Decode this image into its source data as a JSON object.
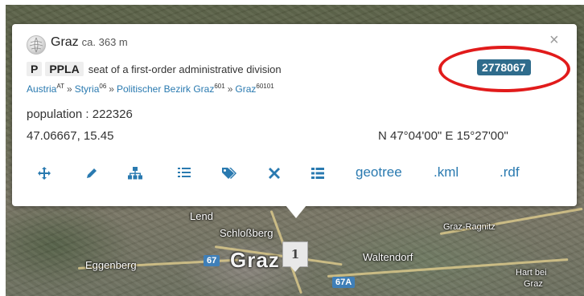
{
  "map": {
    "labels": {
      "lend": "Lend",
      "schlossberg": "Schloßberg",
      "eggenberg": "Eggenberg",
      "graz_big": "Graz",
      "waltendorf": "Waltendorf",
      "graz_ragnitz": "Graz-Ragnitz",
      "hart_bei": "Hart bei",
      "hart_graz": "Graz"
    },
    "routes": {
      "r67": "67",
      "r67a": "67A"
    },
    "cluster_count": "1"
  },
  "popup": {
    "place_name": "Graz",
    "elevation": "ca. 363 m",
    "feature_class": "P",
    "feature_code": "PPLA",
    "feature_description": "seat of a first-order administrative division",
    "geonames_id": "2778067",
    "breadcrumb": [
      {
        "name": "Austria",
        "code": "AT"
      },
      {
        "name": "Styria",
        "code": "06"
      },
      {
        "name": "Politischer Bezirk Graz",
        "code": "601"
      },
      {
        "name": "Graz",
        "code": "60101"
      }
    ],
    "breadcrumb_separator": "»",
    "population_label": "population : 222326",
    "coordinates_decimal": "47.06667, 15.45",
    "coordinates_dms": "N 47°04'00\" E 15°27'00\"",
    "close_symbol": "×",
    "links": {
      "geotree": "geotree",
      "kml": ".kml",
      "rdf": ".rdf"
    },
    "icons": [
      "move-icon",
      "edit-pencil-icon",
      "hierarchy-icon",
      "list-icon",
      "tag-icon",
      "delete-x-icon",
      "details-list-icon"
    ]
  },
  "colors": {
    "link": "#2a7ab0",
    "id_badge": "#2f6c8c",
    "highlight_ellipse": "#e11b1b"
  }
}
